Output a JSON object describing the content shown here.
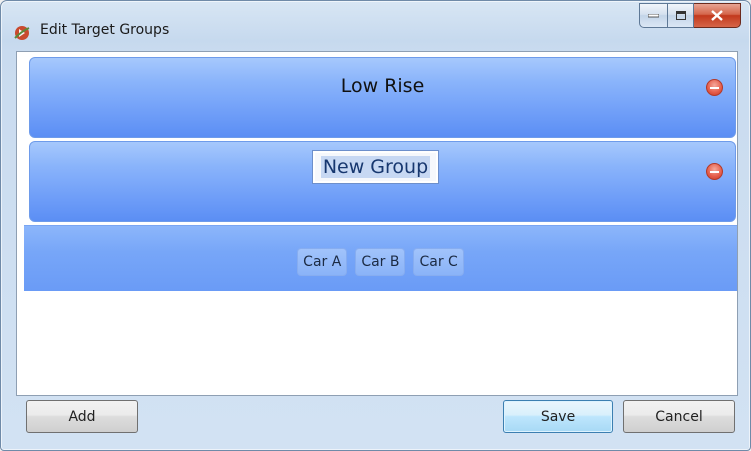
{
  "window": {
    "title": "Edit Target Groups"
  },
  "icons": {
    "app": "app-icon",
    "minimize": "minimize-icon",
    "maximize": "maximize-icon",
    "close": "close-icon",
    "remove": "remove-circle-icon"
  },
  "groups": [
    {
      "name": "Low Rise"
    },
    {
      "name": "New Group",
      "editing": true
    }
  ],
  "unassigned": {
    "cars": [
      "Car A",
      "Car B",
      "Car C"
    ]
  },
  "buttons": {
    "add": "Add",
    "save": "Save",
    "cancel": "Cancel"
  },
  "colors": {
    "group_top": "#a6c8fc",
    "group_bottom": "#5b8ef4",
    "remove_red": "#e45b48",
    "close_red": "#c2381c",
    "save_default": "#3c7fb1"
  }
}
